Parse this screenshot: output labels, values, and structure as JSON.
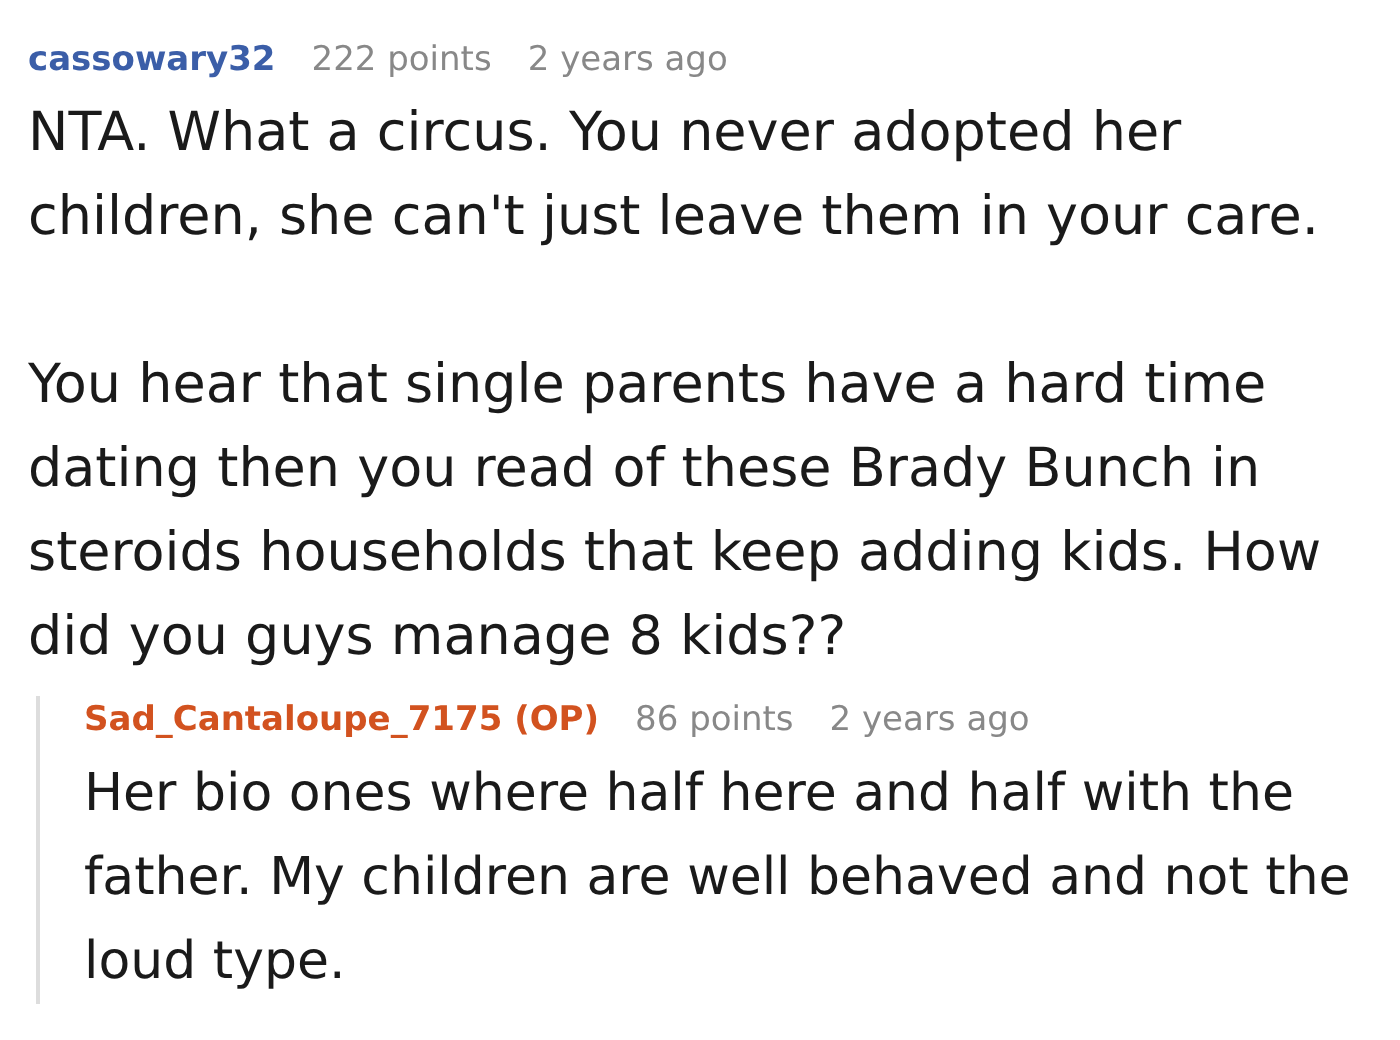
{
  "comments": [
    {
      "author": "cassowary32",
      "points": "222 points",
      "time": "2 years ago",
      "paragraphs": [
        "NTA. What a circus. You never adopted her children, she can't just leave them in your care.",
        "You hear that single parents have a hard time dating then you read of these Brady Bunch in steroids households that keep adding kids. How did you guys manage 8 kids??"
      ],
      "children": [
        {
          "author": "Sad_Cantaloupe_7175 (OP)",
          "is_op": true,
          "points": "86 points",
          "time": "2 years ago",
          "paragraphs": [
            "Her bio ones where half here and half with the father. My children are well behaved and not the loud type."
          ]
        }
      ]
    }
  ]
}
